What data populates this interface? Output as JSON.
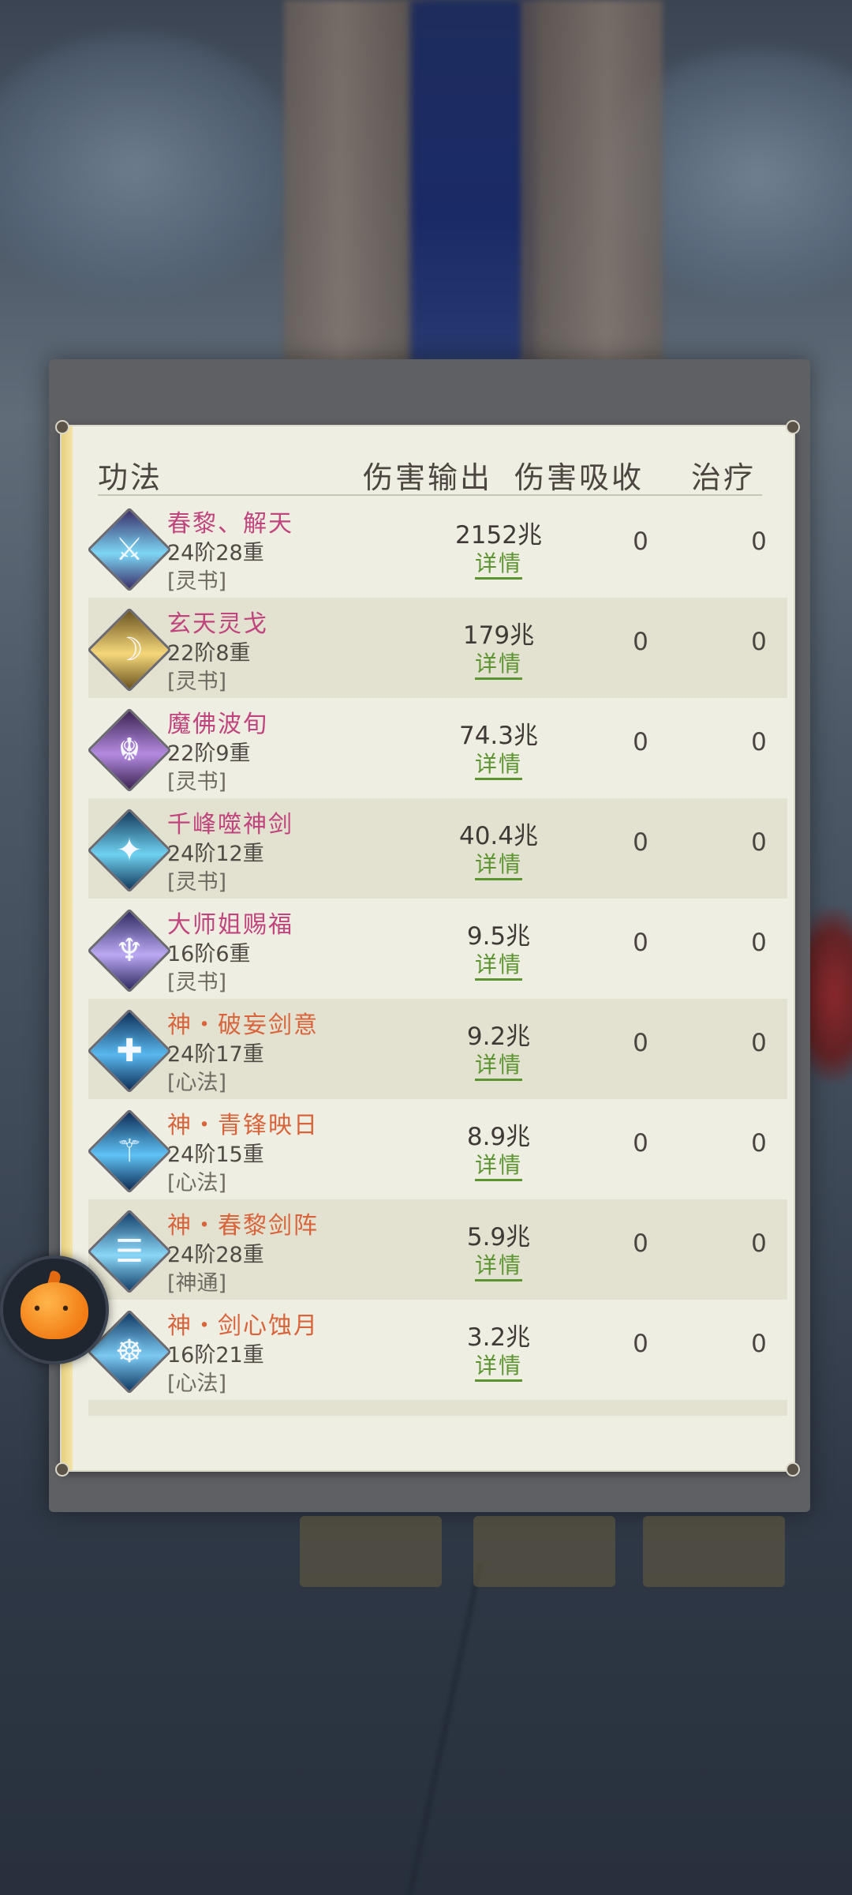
{
  "headers": {
    "col_skill": "功法",
    "col_damage": "伤害输出",
    "col_absorb": "伤害吸收",
    "col_heal": "治疗"
  },
  "detail_label": "详情",
  "rows": [
    {
      "name": "春黎、解天",
      "tier": "24阶28重",
      "type": "[灵书]",
      "damage": "2152兆",
      "absorb": "0",
      "heal": "0",
      "icon": "sword-slash-icon",
      "colors": [
        "#3a2f6a",
        "#7dd6f5"
      ]
    },
    {
      "name": "玄天灵戈",
      "tier": "22阶8重",
      "type": "[灵书]",
      "damage": "179兆",
      "absorb": "0",
      "heal": "0",
      "icon": "golden-blade-icon",
      "colors": [
        "#6b5320",
        "#f5d77a"
      ]
    },
    {
      "name": "魔佛波旬",
      "tier": "22阶9重",
      "type": "[灵书]",
      "damage": "74.3兆",
      "absorb": "0",
      "heal": "0",
      "icon": "demon-buddha-icon",
      "colors": [
        "#3c2452",
        "#b48ae0"
      ]
    },
    {
      "name": "千峰噬神剑",
      "tier": "24阶12重",
      "type": "[灵书]",
      "damage": "40.4兆",
      "absorb": "0",
      "heal": "0",
      "icon": "spinning-sword-icon",
      "colors": [
        "#143a5c",
        "#6fd1f0"
      ]
    },
    {
      "name": "大师姐赐福",
      "tier": "16阶6重",
      "type": "[灵书]",
      "damage": "9.5兆",
      "absorb": "0",
      "heal": "0",
      "icon": "winged-figure-icon",
      "colors": [
        "#2e2a62",
        "#bba8f2"
      ]
    },
    {
      "name": "神・破妄剑意",
      "tier": "24阶17重",
      "type": "[心法]",
      "damage": "9.2兆",
      "absorb": "0",
      "heal": "0",
      "icon": "cross-sword-icon",
      "colors": [
        "#0f2f58",
        "#59b7ee"
      ]
    },
    {
      "name": "神・青锋映日",
      "tier": "24阶15重",
      "type": "[心法]",
      "damage": "8.9兆",
      "absorb": "0",
      "heal": "0",
      "icon": "blue-sword-icon",
      "colors": [
        "#0d2c55",
        "#5fc2f5"
      ]
    },
    {
      "name": "神・春黎剑阵",
      "tier": "24阶28重",
      "type": "[神通]",
      "damage": "5.9兆",
      "absorb": "0",
      "heal": "0",
      "icon": "sword-array-icon",
      "colors": [
        "#14406a",
        "#8ad6f7"
      ]
    },
    {
      "name": "神・剑心蚀月",
      "tier": "16阶21重",
      "type": "[心法]",
      "damage": "3.2兆",
      "absorb": "0",
      "heal": "0",
      "icon": "meditating-figure-icon",
      "colors": [
        "#103a64",
        "#7cc9f2"
      ]
    }
  ]
}
